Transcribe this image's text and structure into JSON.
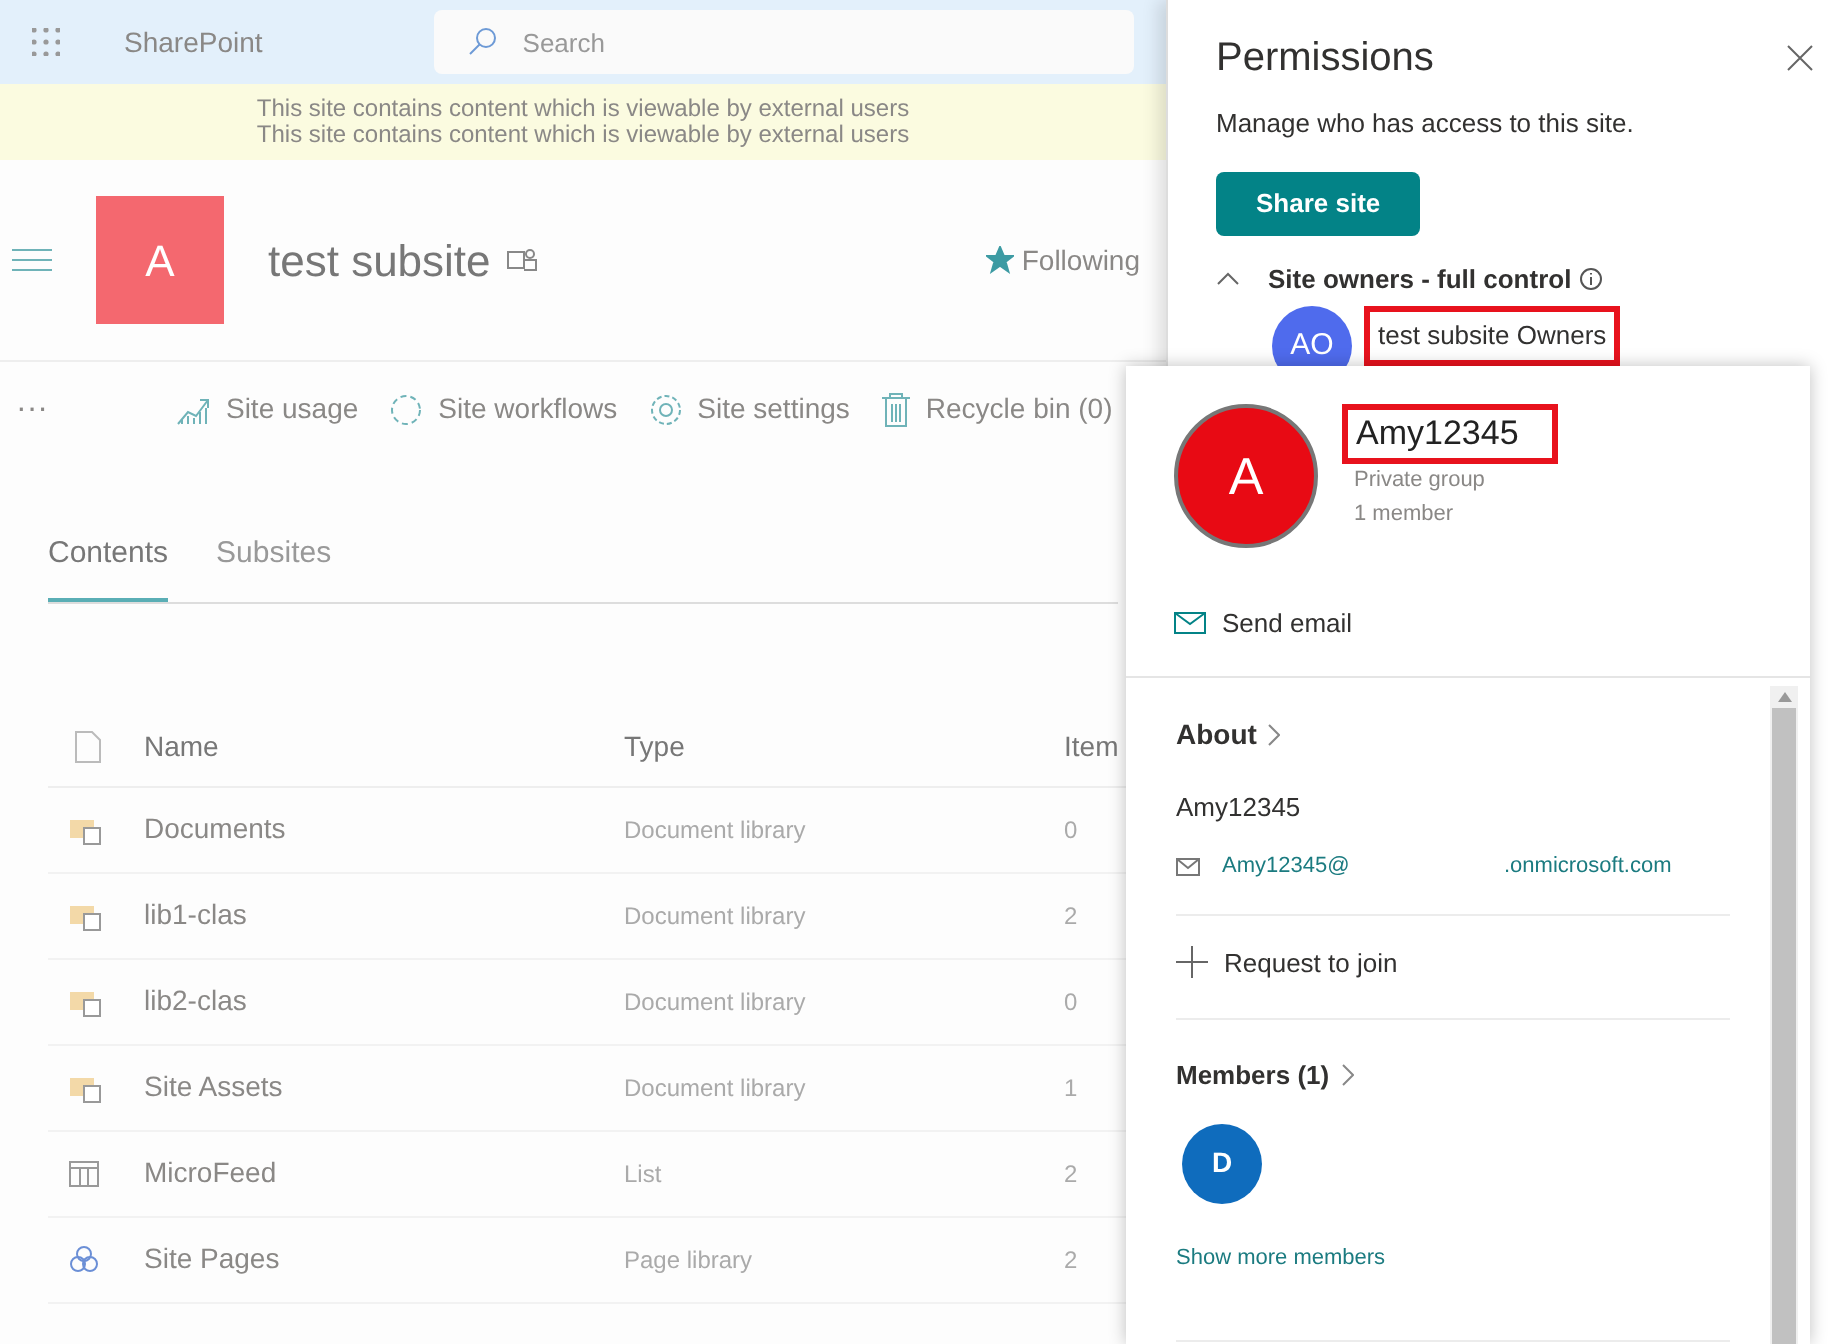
{
  "top_bar": {
    "app_name": "SharePoint",
    "search": {
      "placeholder": "Search"
    }
  },
  "banner": {
    "lines": [
      "This site contains content which is viewable by external users",
      "This site contains content which is viewable by external users"
    ]
  },
  "site_header": {
    "logo_letter": "A",
    "title": "test subsite",
    "follow": {
      "label": "Following",
      "following": true
    }
  },
  "command_bar": {
    "more": "···",
    "items": [
      {
        "kind": "usage",
        "label": "Site usage"
      },
      {
        "kind": "workflows",
        "label": "Site workflows"
      },
      {
        "kind": "settings",
        "label": "Site settings"
      },
      {
        "kind": "recycle",
        "label": "Recycle bin (0)"
      }
    ]
  },
  "tabs": [
    {
      "label": "Contents",
      "selected": true
    },
    {
      "label": "Subsites",
      "selected": false
    }
  ],
  "table": {
    "columns": [
      "Name",
      "Type",
      "Item"
    ],
    "rows": [
      {
        "kind": "library",
        "name": "Documents",
        "type": "Document library",
        "items": "0"
      },
      {
        "kind": "library",
        "name": "lib1-clas",
        "type": "Document library",
        "items": "2"
      },
      {
        "kind": "library",
        "name": "lib2-clas",
        "type": "Document library",
        "items": "0"
      },
      {
        "kind": "library",
        "name": "Site Assets",
        "type": "Document library",
        "items": "1"
      },
      {
        "kind": "list",
        "name": "MicroFeed",
        "type": "List",
        "items": "2"
      },
      {
        "kind": "pages",
        "name": "Site Pages",
        "type": "Page library",
        "items": "2"
      }
    ]
  },
  "permissions": {
    "title": "Permissions",
    "description": "Manage who has access to this site.",
    "share_button": "Share site",
    "section": {
      "label": "Site owners - full control",
      "expanded": true,
      "group": {
        "initials": "AO",
        "name": "test subsite Owners",
        "highlighted": true
      }
    }
  },
  "profile_card": {
    "initial": "A",
    "name": "Amy12345",
    "name_highlighted": true,
    "subtitle": "Private group",
    "member_count": "1 member",
    "send_email": "Send email",
    "about": {
      "heading": "About",
      "name": "Amy12345",
      "email_local": "Amy12345@",
      "email_domain": ".onmicrosoft.com"
    },
    "request_join": "Request to join",
    "members": {
      "heading": "Members (1)",
      "avatars": [
        {
          "initial": "D",
          "color": "#0f6cbd"
        }
      ],
      "show_more": "Show more members"
    }
  }
}
